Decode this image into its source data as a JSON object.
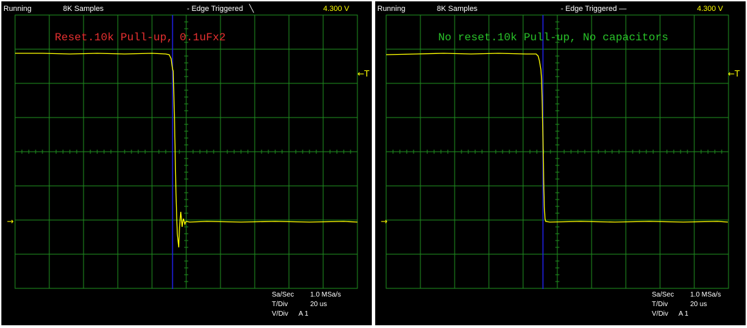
{
  "colors": {
    "grid": "#1f8f1f",
    "trace": "#ffff00",
    "cursor": "#1f1fdf",
    "label_left": "#e83030",
    "label_right": "#29c429",
    "background": "#000000"
  },
  "scopes": [
    {
      "status": {
        "run_state": "Running",
        "samples": "8K Samples",
        "trigger": "- Edge Triggered",
        "trigger_icon": "falling-edge-icon",
        "trigger_glyph": "╲",
        "voltage": "4.300 V"
      },
      "label": "Reset.10k Pull-up, 0.1uFx2",
      "trigger_marker": "←T",
      "ground_marker": "→",
      "info": {
        "sa_sec_key": "Sa/Sec",
        "sa_sec_val": "1.0 MSa/s",
        "t_div_key": "T/Div",
        "t_div_val": "20 us",
        "v_div_key": "V/Div",
        "v_div_val": "A 1"
      }
    },
    {
      "status": {
        "run_state": "Running",
        "samples": "8K Samples",
        "trigger": "- Edge Triggered",
        "trigger_icon": "level-icon",
        "trigger_glyph": "—",
        "voltage": "4.300 V"
      },
      "label": "No reset.10k Pull-up, No capacitors",
      "trigger_marker": "←T",
      "ground_marker": "→",
      "info": {
        "sa_sec_key": "Sa/Sec",
        "sa_sec_val": "1.0 MSa/s",
        "t_div_key": "T/Div",
        "t_div_val": "20 us",
        "v_div_key": "V/Div",
        "v_div_val": "A 1"
      }
    }
  ]
}
